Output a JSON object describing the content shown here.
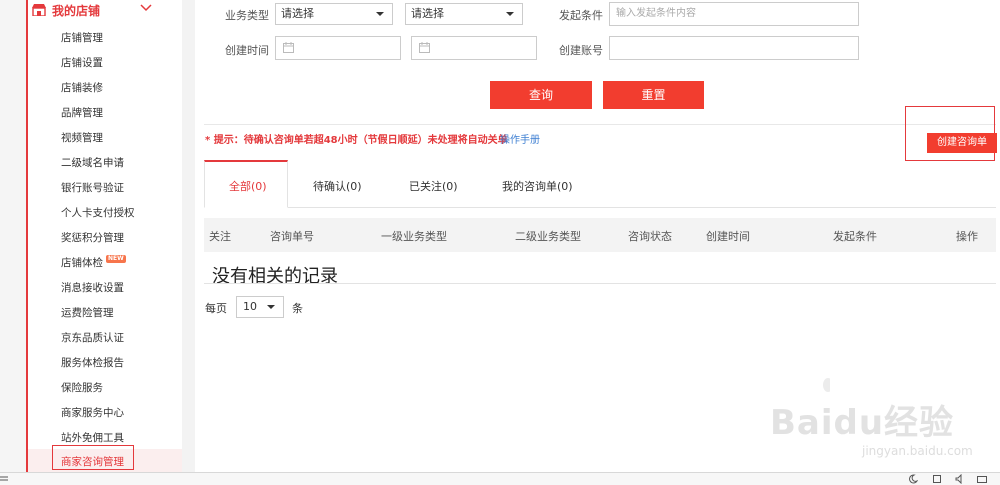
{
  "sidebar": {
    "header": "我的店铺",
    "items": [
      {
        "label": "店铺管理"
      },
      {
        "label": "店铺设置"
      },
      {
        "label": "店铺装修"
      },
      {
        "label": "品牌管理"
      },
      {
        "label": "视频管理"
      },
      {
        "label": "二级域名申请"
      },
      {
        "label": "银行账号验证"
      },
      {
        "label": "个人卡支付授权"
      },
      {
        "label": "奖惩积分管理"
      },
      {
        "label": "店铺体检",
        "badge": "NEW"
      },
      {
        "label": "消息接收设置"
      },
      {
        "label": "运费险管理"
      },
      {
        "label": "京东品质认证"
      },
      {
        "label": "服务体检报告"
      },
      {
        "label": "保险服务"
      },
      {
        "label": "商家服务中心"
      },
      {
        "label": "站外免佣工具"
      },
      {
        "label": "商家咨询管理",
        "active": true
      }
    ]
  },
  "filters": {
    "business_type_label": "业务类型",
    "select1_value": "请选择",
    "select2_value": "请选择",
    "trigger_label": "发起条件",
    "trigger_placeholder": "输入发起条件内容",
    "created_time_label": "创建时间",
    "created_account_label": "创建账号",
    "query_button": "查询",
    "reset_button": "重置"
  },
  "tip": {
    "text": "* 提示：待确认咨询单若超48小时（节假日顺延）未处理将自动关单",
    "link": "操作手册"
  },
  "create_button": "创建咨询单",
  "tabs": [
    {
      "label": "全部(0)",
      "active": true
    },
    {
      "label": "待确认(0)"
    },
    {
      "label": "已关注(0)"
    },
    {
      "label": "我的咨询单(0)"
    }
  ],
  "table": {
    "columns": [
      "关注",
      "咨询单号",
      "一级业务类型",
      "二级业务类型",
      "咨询状态",
      "创建时间",
      "发起条件",
      "操作"
    ],
    "empty_text": "没有相关的记录"
  },
  "pagination": {
    "per_page_label": "每页",
    "per_page_value": "10",
    "unit": "条"
  },
  "watermark": {
    "brand": "Baidu经验",
    "url": "jingyan.baidu.com"
  },
  "colors": {
    "accent": "#e4393c",
    "button": "#f23d2f",
    "link": "#3e7fd2"
  }
}
